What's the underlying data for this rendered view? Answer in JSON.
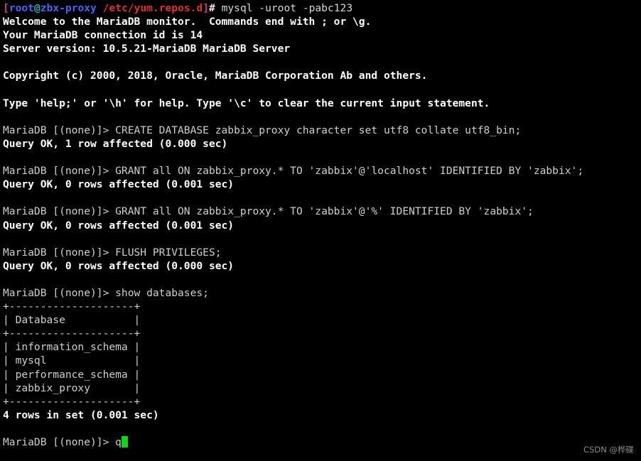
{
  "terminal": {
    "background_color": "#000000",
    "foreground_color": "#d8d8d8",
    "cursor_color": "#00e000",
    "prompt_colors": {
      "bracket": "#d33682",
      "user": "#4466ff",
      "at": "#19b5b5",
      "host": "#4466ff",
      "path": "#e4302a",
      "hash": "#e8e8e8"
    },
    "shell_prompt": {
      "open_bracket": "[",
      "user": "root",
      "at": "@",
      "host": "zbx-proxy",
      "space": " ",
      "path": "/etc/yum.repos.d",
      "close_bracket": "]",
      "hash": "#",
      "command": " mysql -uroot -pabc123"
    },
    "lines": [
      {
        "id": "l02",
        "text": "Welcome to the MariaDB monitor.  Commands end with ; or \\g.",
        "style": "bold"
      },
      {
        "id": "l03",
        "text": "Your MariaDB connection id is 14",
        "style": "bold"
      },
      {
        "id": "l04",
        "text": "Server version: 10.5.21-MariaDB MariaDB Server",
        "style": "bold"
      },
      {
        "id": "l05",
        "text": "",
        "style": "blank"
      },
      {
        "id": "l06",
        "text": "Copyright (c) 2000, 2018, Oracle, MariaDB Corporation Ab and others.",
        "style": "bold"
      },
      {
        "id": "l07",
        "text": "",
        "style": "blank"
      },
      {
        "id": "l08",
        "text": "Type 'help;' or '\\h' for help. Type '\\c' to clear the current input statement.",
        "style": "bold"
      },
      {
        "id": "l09",
        "text": "",
        "style": "blank"
      },
      {
        "id": "l10",
        "text": "MariaDB [(none)]> CREATE DATABASE zabbix_proxy character set utf8 collate utf8_bin;",
        "style": "plain"
      },
      {
        "id": "l11",
        "text": "Query OK, 1 row affected (0.000 sec)",
        "style": "bold"
      },
      {
        "id": "l12",
        "text": "",
        "style": "blank"
      },
      {
        "id": "l13",
        "text": "MariaDB [(none)]> GRANT all ON zabbix_proxy.* TO 'zabbix'@'localhost' IDENTIFIED BY 'zabbix';",
        "style": "plain"
      },
      {
        "id": "l14",
        "text": "Query OK, 0 rows affected (0.001 sec)",
        "style": "bold"
      },
      {
        "id": "l15",
        "text": "",
        "style": "blank"
      },
      {
        "id": "l16",
        "text": "MariaDB [(none)]> GRANT all ON zabbix_proxy.* TO 'zabbix'@'%' IDENTIFIED BY 'zabbix';",
        "style": "plain"
      },
      {
        "id": "l17",
        "text": "Query OK, 0 rows affected (0.001 sec)",
        "style": "bold"
      },
      {
        "id": "l18",
        "text": "",
        "style": "blank"
      },
      {
        "id": "l19",
        "text": "MariaDB [(none)]> FLUSH PRIVILEGES;",
        "style": "plain"
      },
      {
        "id": "l20",
        "text": "Query OK, 0 rows affected (0.000 sec)",
        "style": "bold"
      },
      {
        "id": "l21",
        "text": "",
        "style": "blank"
      },
      {
        "id": "l22",
        "text": "MariaDB [(none)]> show databases;",
        "style": "plain"
      },
      {
        "id": "l23",
        "text": "+--------------------+",
        "style": "plain"
      },
      {
        "id": "l24",
        "text": "| Database           |",
        "style": "plain"
      },
      {
        "id": "l25",
        "text": "+--------------------+",
        "style": "plain"
      },
      {
        "id": "l26",
        "text": "| information_schema |",
        "style": "plain"
      },
      {
        "id": "l27",
        "text": "| mysql              |",
        "style": "plain"
      },
      {
        "id": "l28",
        "text": "| performance_schema |",
        "style": "plain"
      },
      {
        "id": "l29",
        "text": "| zabbix_proxy       |",
        "style": "plain"
      },
      {
        "id": "l30",
        "text": "+--------------------+",
        "style": "plain"
      },
      {
        "id": "l31",
        "text": "4 rows in set (0.001 sec)",
        "style": "bold"
      },
      {
        "id": "l32",
        "text": "",
        "style": "blank"
      }
    ],
    "final_prompt": {
      "prompt": "MariaDB [(none)]> ",
      "typed": "q"
    },
    "result_table": {
      "header": "Database",
      "rows": [
        "information_schema",
        "mysql",
        "performance_schema",
        "zabbix_proxy"
      ],
      "row_count_text": "4 rows in set (0.001 sec)"
    }
  },
  "watermark": {
    "text": "CSDN @桦碟"
  }
}
